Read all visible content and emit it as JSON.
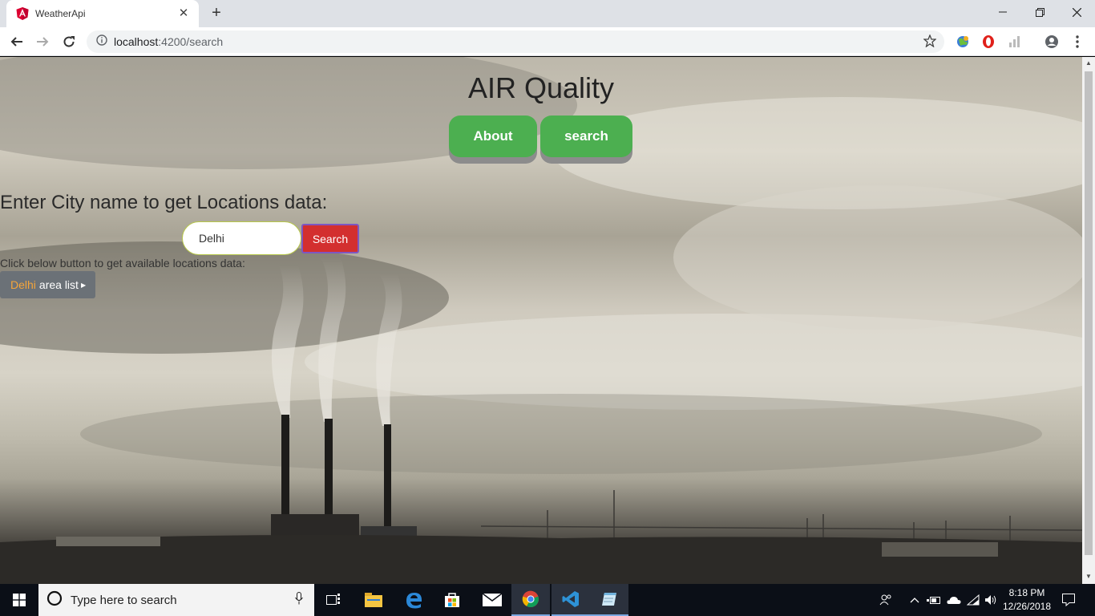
{
  "browser": {
    "tab_title": "WeatherApi",
    "url_host": "localhost",
    "url_path": ":4200/search",
    "new_tab_glyph": "+",
    "tab_close_glyph": "✕"
  },
  "app": {
    "title": "AIR Quality",
    "nav": {
      "about_label": "About",
      "search_label": "search"
    },
    "prompt": "Enter City name to get Locations data:",
    "city_input_value": "Delhi",
    "search_button_label": "Search",
    "hint": "Click below button to get available locations data:",
    "area_button": {
      "city": "Delhi",
      "label": "area list"
    },
    "colors": {
      "nav_green": "#4caf50",
      "search_red": "#d32f2f",
      "area_button_gray": "#6b7177",
      "area_city_orange": "#f5a53a"
    }
  },
  "taskbar": {
    "search_placeholder": "Type here to search",
    "time": "8:18 PM",
    "date": "12/26/2018",
    "pinned_icons": [
      "task-view-icon",
      "file-explorer-icon",
      "edge-icon",
      "store-icon",
      "mail-icon",
      "chrome-icon",
      "vscode-icon",
      "notepad-icon"
    ],
    "tray_icons": [
      "people-icon",
      "chevron-up-icon",
      "battery-icon",
      "onedrive-icon",
      "wifi-icon",
      "volume-icon",
      "notification-icon"
    ]
  }
}
